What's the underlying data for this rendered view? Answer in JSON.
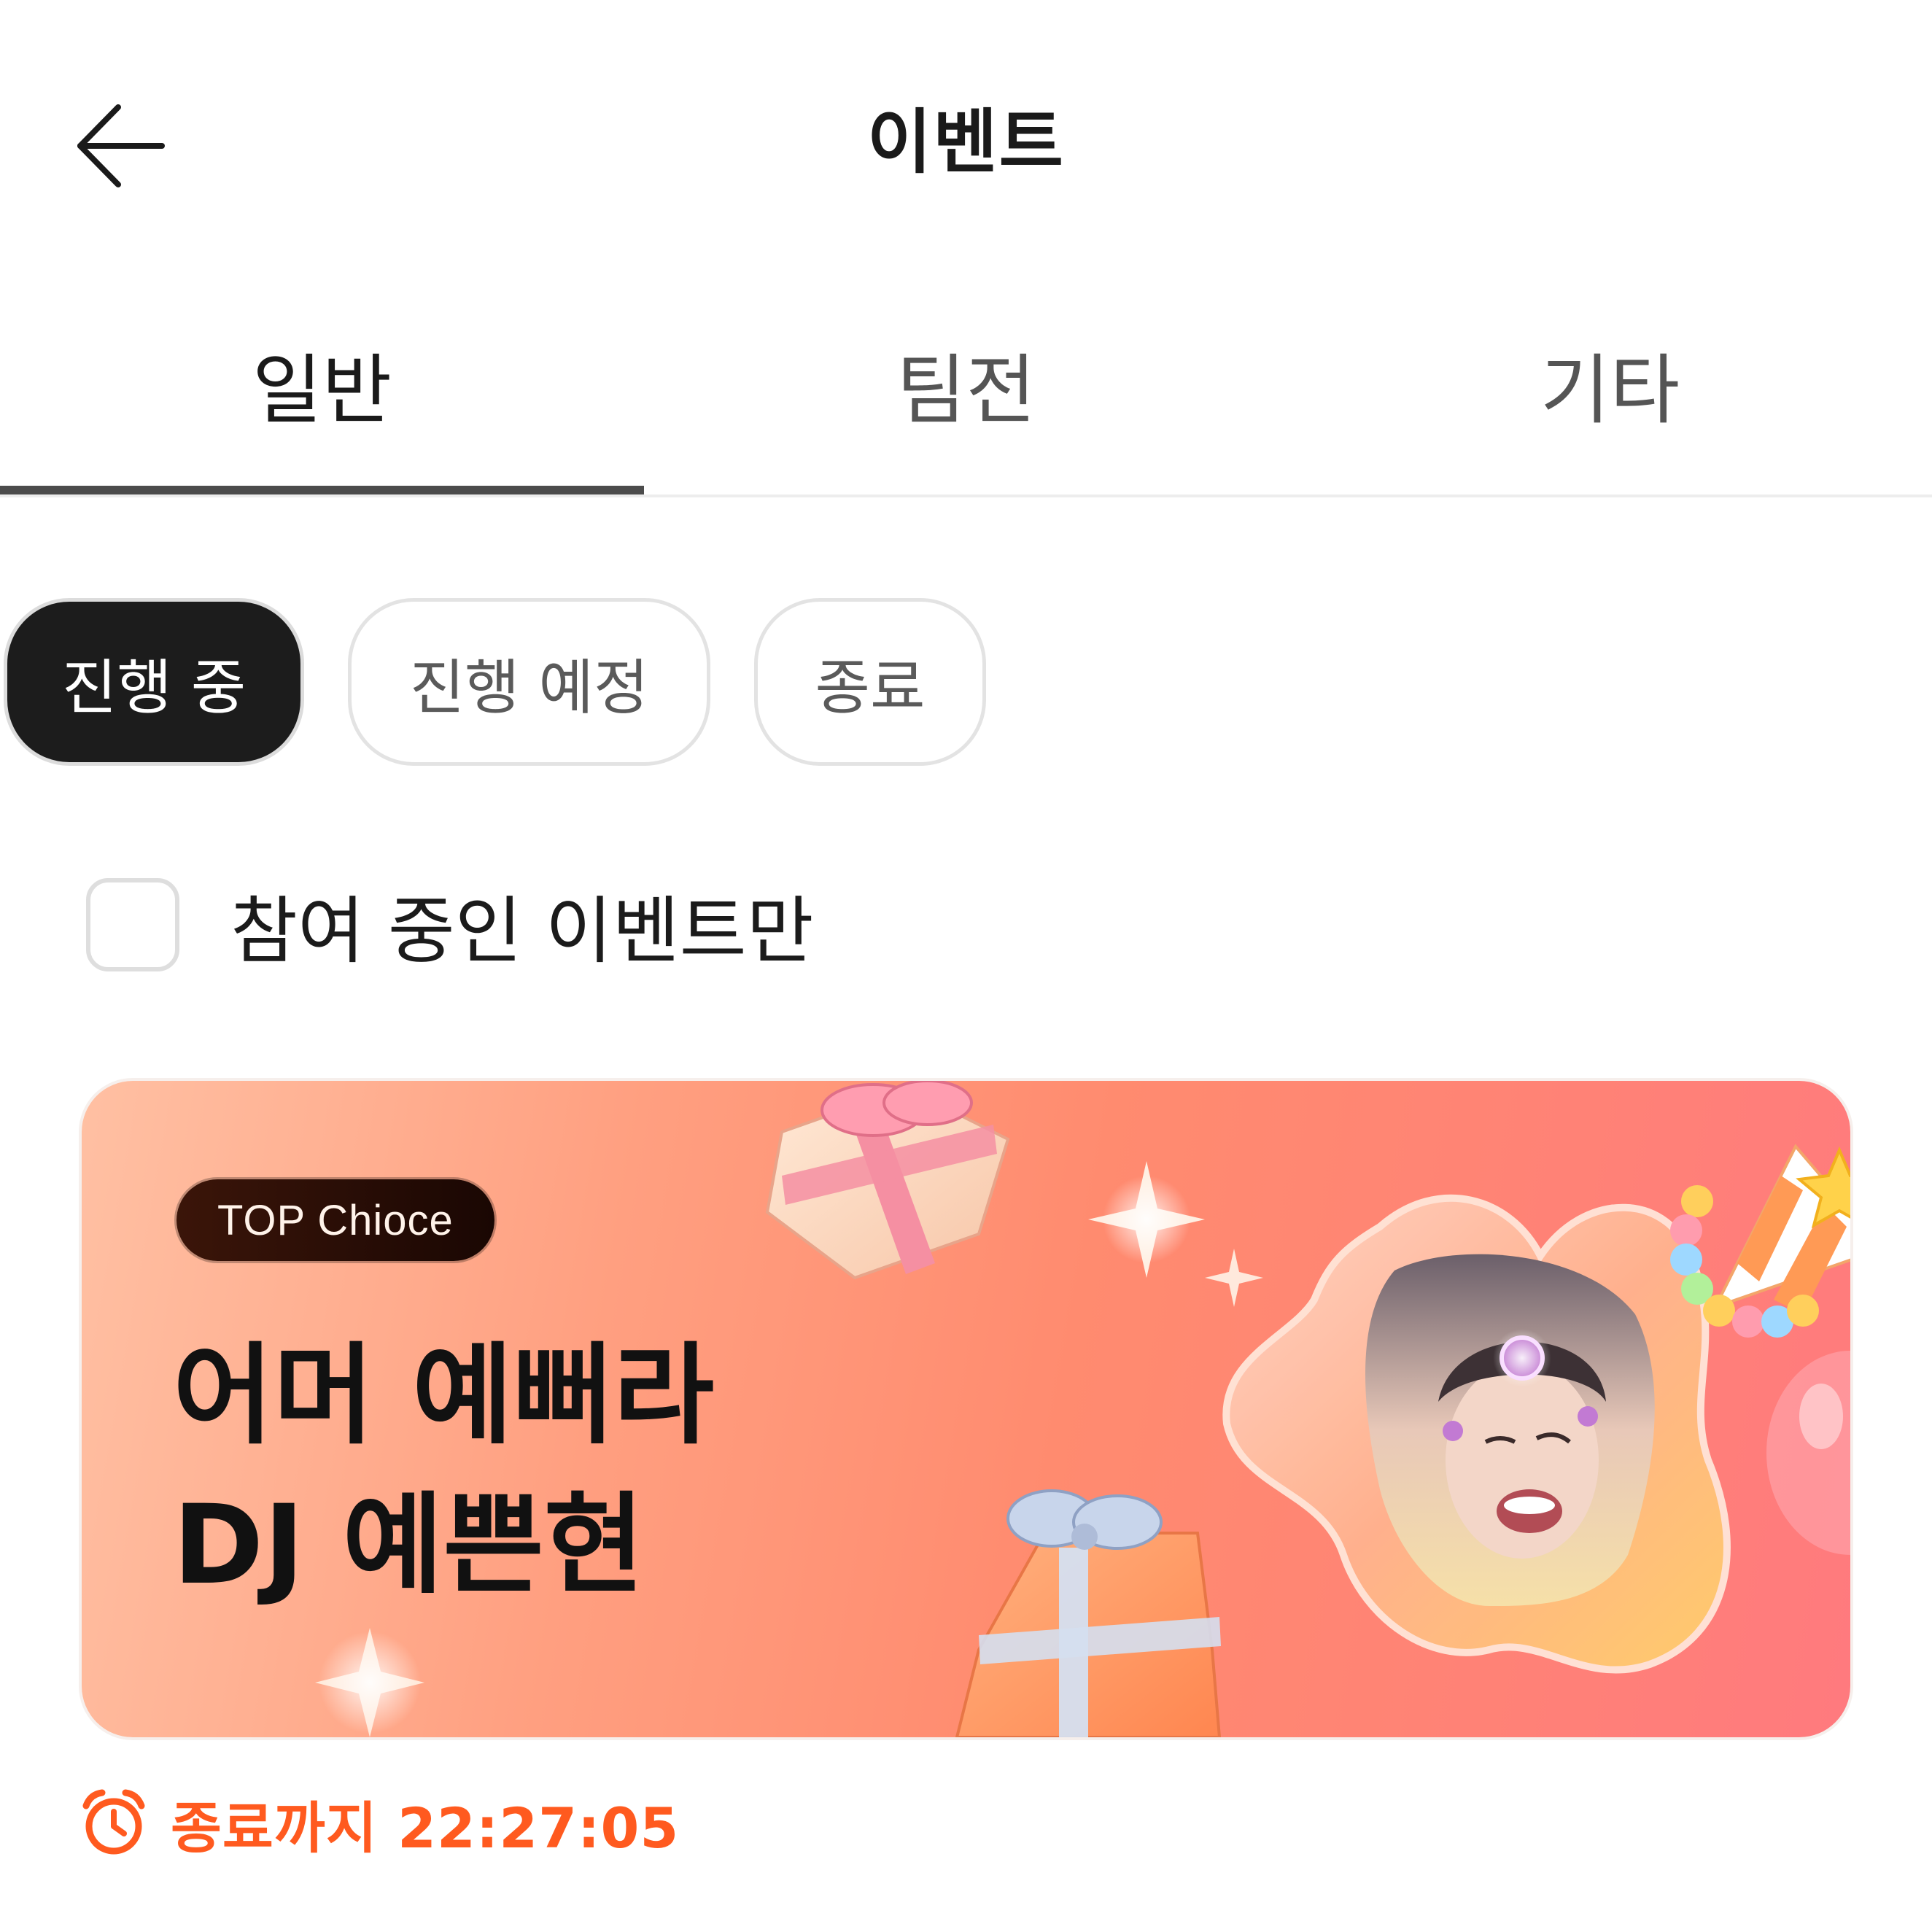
{
  "header": {
    "title": "이벤트",
    "back_icon": "arrow-left-icon"
  },
  "tabs": [
    {
      "label": "일반",
      "active": true
    },
    {
      "label": "팀전",
      "active": false
    },
    {
      "label": "기타",
      "active": false
    }
  ],
  "filters": [
    {
      "label": "진행 중",
      "active": true
    },
    {
      "label": "진행 예정",
      "active": false
    },
    {
      "label": "종료",
      "active": false
    }
  ],
  "participating_only": {
    "label": "참여 중인 이벤트만",
    "checked": false
  },
  "event_card": {
    "badge": "TOP Chioce",
    "title_line1": "어머 예뻐라",
    "title_line2": "DJ 예쁜현"
  },
  "countdown": {
    "icon": "alarm-clock-icon",
    "text": "종료까지 22:27:05",
    "color": "#ff5a1f"
  },
  "colors": {
    "accent": "#ff5a1f",
    "chip_active_bg": "#1c1c1c",
    "tab_indicator": "#4c4c4c"
  }
}
